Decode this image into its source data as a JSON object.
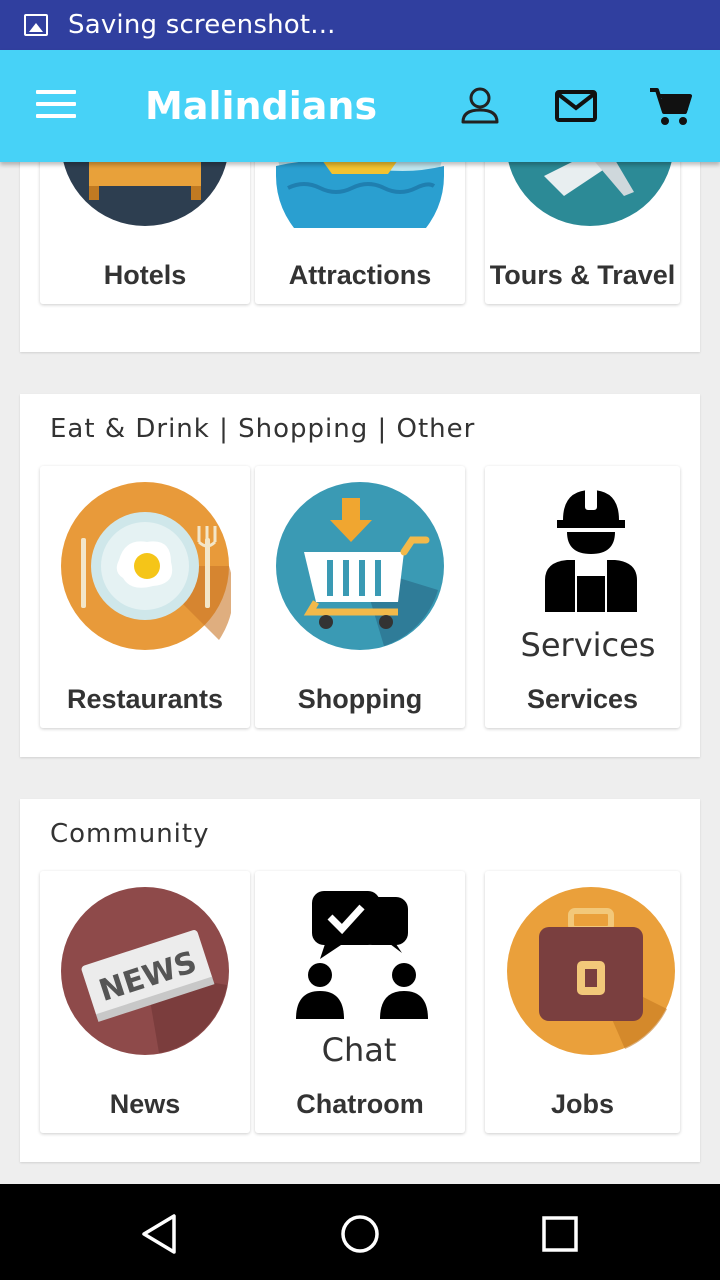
{
  "status_bar": {
    "text": "Saving screenshot..."
  },
  "app_bar": {
    "title": "Malindians"
  },
  "sections": [
    {
      "title": "",
      "tiles": [
        {
          "label": "Hotels"
        },
        {
          "label": "Attractions"
        },
        {
          "label": "Tours & Travel"
        }
      ]
    },
    {
      "title": "Eat & Drink | Shopping | Other",
      "tiles": [
        {
          "label": "Restaurants"
        },
        {
          "label": "Shopping"
        },
        {
          "label": "Services",
          "art_text": "Services"
        }
      ]
    },
    {
      "title": "Community",
      "tiles": [
        {
          "label": "News",
          "art_text": "NEWS"
        },
        {
          "label": "Chatroom",
          "art_text": "Chat"
        },
        {
          "label": "Jobs"
        }
      ]
    }
  ],
  "colors": {
    "app_bar": "#47d2f7",
    "status_bar": "#303f9f",
    "nav_bar": "#000000"
  }
}
